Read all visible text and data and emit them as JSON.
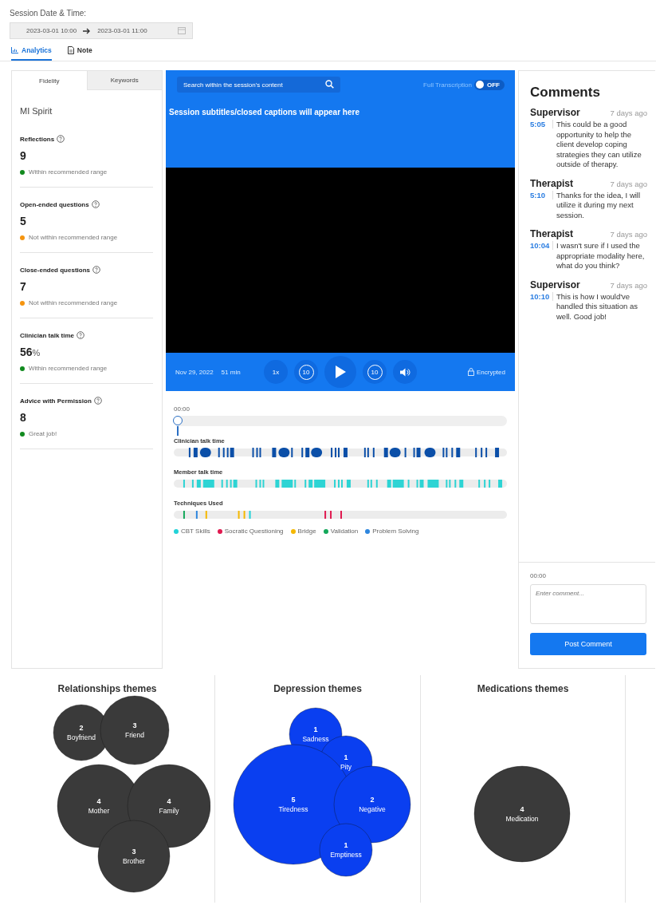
{
  "session": {
    "label": "Session Date & Time:",
    "start": "2023-03-01 10:00",
    "end": "2023-03-01 11:00"
  },
  "tabs": [
    {
      "label": "Analytics",
      "selected": true,
      "kind": "chart"
    },
    {
      "label": "Note",
      "selected": false,
      "kind": "doc"
    }
  ],
  "fidelity_panel": {
    "tabs": [
      {
        "label": "Fidelity",
        "selected": true
      },
      {
        "label": "Keywords",
        "selected": false
      }
    ],
    "heading": "MI Spirit",
    "metrics": [
      {
        "title": "Reflections",
        "value": "9",
        "status": "Within recommended range",
        "color": "#118a1e"
      },
      {
        "title": "Open-ended questions",
        "value": "5",
        "status": "Not within recommended range",
        "color": "#f5940f"
      },
      {
        "title": "Close-ended questions",
        "value": "7",
        "status": "Not within recommended range",
        "color": "#f5940f"
      },
      {
        "title": "Clinician talk time",
        "value": "56",
        "unit": "%",
        "status": "Within recommended range",
        "color": "#118a1e"
      },
      {
        "title": "Advice with Permission",
        "value": "8",
        "status": "Great job!",
        "color": "#118a1e"
      }
    ]
  },
  "player": {
    "search": {
      "placeholder": "Search within the session's content"
    },
    "transcription": {
      "label": "Full Transcription",
      "on": false,
      "state_label": "OFF"
    },
    "subtitle": "Session subtitles/closed captions will appear here",
    "date": "Nov 29, 2022",
    "duration": "51 min",
    "encrypted": "Encrypted",
    "speed": "1x",
    "rewind": "10",
    "forward": "10"
  },
  "timeline": {
    "time": "00:00",
    "level": 0,
    "tracks": [
      {
        "label": "Clinician talk time",
        "kind": "clinician"
      },
      {
        "label": "Member talk time",
        "kind": "member"
      },
      {
        "label": "Techniques Used",
        "kind": "techniques"
      }
    ],
    "legend": [
      {
        "label": "CBT Skills",
        "color": "#22d3d8"
      },
      {
        "label": "Socratic Questioning",
        "color": "#e0194f"
      },
      {
        "label": "Bridge",
        "color": "#f5b800"
      },
      {
        "label": "Validation",
        "color": "#13a85a"
      },
      {
        "label": "Problem Solving",
        "color": "#2e86de"
      }
    ]
  },
  "comments": {
    "title": "Comments",
    "items": [
      {
        "author": "Supervisor",
        "age": "7 days ago",
        "time": "5:05",
        "text": "This could be a good opportunity to help the client develop coping strategies they can utilize outside of therapy."
      },
      {
        "author": "Therapist",
        "age": "7 days ago",
        "time": "5:10",
        "text": "Thanks for the idea, I will utilize it during my next session."
      },
      {
        "author": "Therapist",
        "age": "7 days ago",
        "time": "10:04",
        "text": "I wasn't sure if I used the appropriate modality here, what do you think?"
      },
      {
        "author": "Supervisor",
        "age": "7 days ago",
        "time": "10:10",
        "text": "This is how I would've handled this situation as well. Good job!"
      }
    ],
    "time": "00:00",
    "placeholder": "Enter comment...",
    "button": "Post Comment"
  },
  "themes": [
    {
      "title": "Relationships themes",
      "color": "#3a3a3a",
      "bubbles": [
        {
          "count": "2",
          "label": "Boyfriend"
        },
        {
          "count": "3",
          "label": "Friend"
        },
        {
          "count": "4",
          "label": "Mother"
        },
        {
          "count": "4",
          "label": "Family"
        },
        {
          "count": "3",
          "label": "Brother"
        }
      ]
    },
    {
      "title": "Depression themes",
      "color": "#0a3ff0",
      "bubbles": [
        {
          "count": "1",
          "label": "Sadness"
        },
        {
          "count": "1",
          "label": "Pity"
        },
        {
          "count": "5",
          "label": "Tiredness"
        },
        {
          "count": "2",
          "label": "Negative"
        },
        {
          "count": "1",
          "label": "Emptiness"
        }
      ]
    },
    {
      "title": "Medications themes",
      "color": "#3a3a3a",
      "bubbles": [
        {
          "count": "4",
          "label": "Medication"
        }
      ]
    }
  ]
}
